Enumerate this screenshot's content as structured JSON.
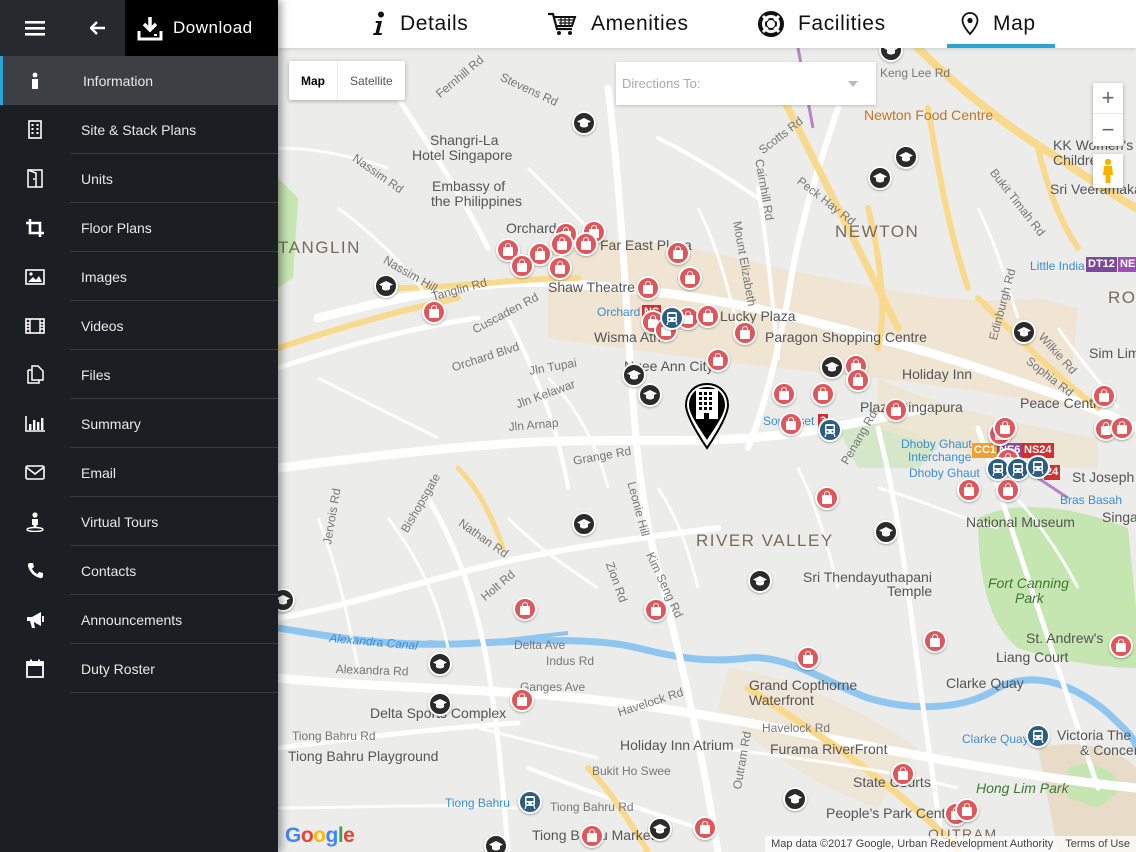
{
  "header": {
    "download_label": "Download"
  },
  "sidebar": {
    "items": [
      {
        "label": "Information",
        "icon": "info-icon"
      },
      {
        "label": "Site & Stack Plans",
        "icon": "building-icon"
      },
      {
        "label": "Units",
        "icon": "door-icon"
      },
      {
        "label": "Floor Plans",
        "icon": "crop-icon"
      },
      {
        "label": "Images",
        "icon": "image-icon"
      },
      {
        "label": "Videos",
        "icon": "film-icon"
      },
      {
        "label": "Files",
        "icon": "files-icon"
      },
      {
        "label": "Summary",
        "icon": "bar-chart-icon"
      },
      {
        "label": "Email",
        "icon": "envelope-icon"
      },
      {
        "label": "Virtual Tours",
        "icon": "person-pin-icon"
      },
      {
        "label": "Contacts",
        "icon": "phone-icon"
      },
      {
        "label": "Announcements",
        "icon": "megaphone-icon"
      },
      {
        "label": "Duty Roster",
        "icon": "calendar-icon"
      }
    ],
    "active": "Information"
  },
  "tabs": [
    {
      "label": "Details",
      "icon": "info-italic-icon"
    },
    {
      "label": "Amenities",
      "icon": "cart-icon"
    },
    {
      "label": "Facilities",
      "icon": "lifebuoy-icon"
    },
    {
      "label": "Map",
      "icon": "location-pin-icon",
      "active": true
    }
  ],
  "map": {
    "type_buttons": {
      "map": "Map",
      "satellite": "Satellite"
    },
    "directions_placeholder": "Directions To:",
    "zoom_in": "+",
    "zoom_out": "−",
    "google": "Google",
    "attribution": "Map data ©2017 Google, Urban Redevelopment Authority",
    "terms": "Terms of Use",
    "areas": {
      "newton": "NEWTON",
      "tanglin": "TANGLIN",
      "river_valley": "RIVER VALLEY",
      "ro": "RO"
    },
    "places": {
      "shangri": "Shangri-La",
      "shangri2": "Hotel Singapore",
      "embassy": "Embassy of",
      "embassy2": "the Philippines",
      "orchard": "Orchard",
      "fareast": "Far East Plaza",
      "shaw": "Shaw Theatre",
      "lucky": "Lucky Plaza",
      "wisma": "Wisma Atria",
      "paragon": "Paragon Shopping Centre",
      "holiday": "Holiday Inn",
      "plaza_sg": "Plaza Singapura",
      "peace": "Peace Centre",
      "newton_food": "Newton Food Centre",
      "kk": "KK Women's",
      "kk2": "Children's",
      "sri_veer": "Sri Veeramakaliamman",
      "little_india": "Little India",
      "sim_lim": "Sim Lim",
      "st_joseph": "St Joseph",
      "dhoby": "Dhoby Ghaut",
      "dhoby2": "Interchange",
      "dhoby3": "Dhoby Ghaut",
      "bras": "Bras Basah",
      "national": "National Museum",
      "sing": "Singapore",
      "sri_then": "Sri Thendayuthapani",
      "sri_then2": "Temple",
      "fort": "Fort Canning",
      "fort2": "Park",
      "st_andrew": "St. Andrew's",
      "liang": "Liang Court",
      "clarke": "Clarke Quay",
      "clarke2": "Clarke Quay",
      "victoria": "Victoria The",
      "victoria2": "& Concert",
      "grand": "Grand Copthorne",
      "grand2": "Waterfront",
      "delta": "Delta Sports Complex",
      "holiday_atrium": "Holiday Inn Atrium",
      "furama": "Furama RiverFront",
      "tiong_pg": "Tiong Bahru Playground",
      "tiong_station": "Tiong Bahru",
      "tiong_market": "Tiong Bahru Market",
      "state": "State Courts",
      "peoples": "People's Park Centre",
      "hong_lim": "Hong Lim Park",
      "outram": "OUTRAM",
      "ngee": "Ngee Ann City",
      "orchard_st": "Orchard",
      "somerset": "Somerset"
    },
    "roads": {
      "scotts": "Scotts Rd",
      "stevens": "Stevens Rd",
      "fernhill": "Fernhill Rd",
      "nassim": "Nassim Rd",
      "nassim_hill": "Nassim Hill",
      "tanglin": "Tanglin Rd",
      "cuscaden": "Cuscaden Rd",
      "orchard_blvd": "Orchard Blvd",
      "jln_tupai": "Jln Tupai",
      "jln_kelawar": "Jln Kelawar",
      "jln_arnap": "Jln Arnap",
      "grange": "Grange Rd",
      "bishopsgate": "Bishopsgate",
      "nathan": "Nathan Rd",
      "leonie": "Leonie Hill",
      "jervois": "Jervois Rd",
      "holt": "Holt Rd",
      "zion": "Zion Rd",
      "kim_seng": "Kim Seng Rd",
      "alexandra": "Alexandra Rd",
      "alexandra_canal": "Alexandra Canal",
      "indus": "Indus Rd",
      "delta_ave": "Delta Ave",
      "ganges": "Ganges Ave",
      "havelock": "Havelock Rd",
      "havelock2": "Havelock Rd",
      "bukit_ho": "Bukit Ho Swee",
      "tiong_rd": "Tiong Bahru Rd",
      "tiong_rd2": "Tiong Bahru Rd",
      "outram_rd": "Outram Rd",
      "cairnhill": "Cairnhill Rd",
      "peck_hay": "Peck Hay Rd",
      "mount_eliz": "Mount Elizabeth",
      "bukit_timah": "Bukit Timah Rd",
      "kenny": "Keng Lee Rd",
      "edinburgh": "Edinburgh Rd",
      "wilkie": "Wilkie Rd",
      "sophia": "Sophia Rd",
      "penang": "Penang Rd"
    },
    "mrt": {
      "dt12": "DT12",
      "ne": "NE",
      "cc1": "CC1",
      "ne6": "NE6",
      "ns24": "NS24",
      "n24": "24",
      "ns": "NS",
      "ns23": "3"
    }
  },
  "colors": {
    "accent": "#2aa3d6",
    "sidebar": "#1b1e23",
    "shop_pin": "#e0575b",
    "water": "#8fc6f0",
    "park": "#c5e5b1"
  }
}
